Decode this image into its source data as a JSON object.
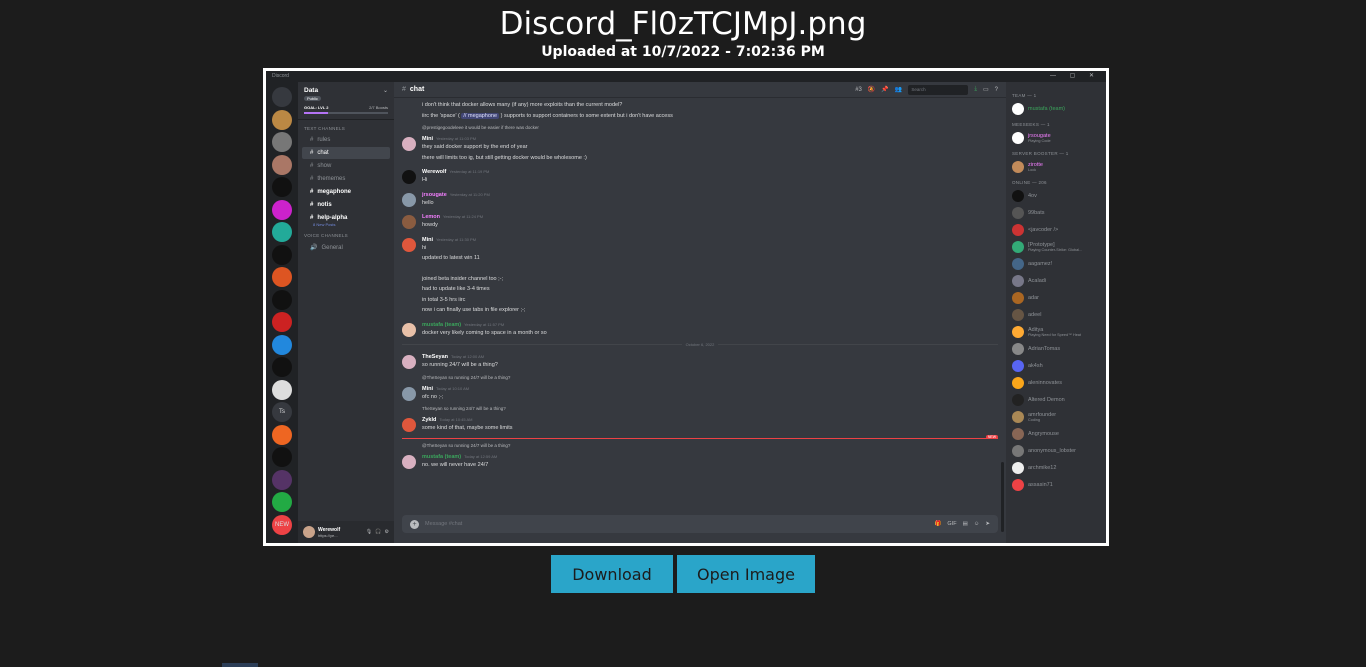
{
  "page": {
    "title": "Discord_Fl0zTCJMpJ.png",
    "uploaded": "Uploaded at 10/7/2022 - 7:02:36 PM",
    "download_label": "Download",
    "open_label": "Open Image"
  },
  "discord": {
    "app_name": "Discord",
    "guild": {
      "name": "Data",
      "public": "Public",
      "goal": "GOAL: LVL 2",
      "boosts": "2/7 Boosts"
    },
    "categories": {
      "text": "TEXT CHANNELS",
      "voice": "VOICE CHANNELS"
    },
    "channels": [
      {
        "name": "rules",
        "state": "normal"
      },
      {
        "name": "chat",
        "state": "active"
      },
      {
        "name": "show",
        "state": "normal"
      },
      {
        "name": "thememes",
        "state": "normal"
      },
      {
        "name": "megaphone",
        "state": "unread"
      },
      {
        "name": "notis",
        "state": "unread"
      },
      {
        "name": "help-alpha",
        "state": "unread",
        "sub": "8 New Posts"
      }
    ],
    "voice_channels": [
      {
        "name": "General"
      }
    ],
    "user": {
      "name": "Werewolf",
      "status": "https://ye..."
    },
    "header": {
      "channel": "chat",
      "search": "Search",
      "threads": "3"
    },
    "composer_placeholder": "Message #chat",
    "messages": [
      {
        "lines": [
          "i don't think that docker allows many (if any) more exploits than the current model?"
        ],
        "continuation": true
      },
      {
        "pre": "iirc the 'space' (",
        "mention": "// megaphone",
        "post": ") supports to support containers to some extent but i don't have access",
        "continuation": true
      },
      {
        "reply": "@prestigegoodeleee it would be easier if there was docker"
      },
      {
        "author": "Mini",
        "time": "Yesterday at 11:03 PM",
        "color": "#fff",
        "lines": [
          "they said docker support by the end of year",
          "there will limits too ig, but still getting docker would be wholesome :)"
        ]
      },
      {
        "author": "Werewolf",
        "time": "Yesterday at 11:19 PM",
        "color": "#fff",
        "lines": [
          "Hi"
        ]
      },
      {
        "author": "jrsougate",
        "time": "Yesterday at 11:20 PM",
        "color": "#f47fff",
        "lines": [
          "hello"
        ]
      },
      {
        "author": "Lemon",
        "time": "Yesterday at 11:24 PM",
        "color": "#f47fff",
        "lines": [
          "howdy"
        ]
      },
      {
        "author": "Mini",
        "time": "Yesterday at 11:30 PM",
        "color": "#fff",
        "lines": [
          "hi",
          "updated to latest win 11",
          "",
          "joined beta insider channel too ;-;",
          "had to update like 3-4 times",
          "in total 3-5 hrs iirc",
          "now i can finally use tabs in file explorer ;-;"
        ]
      },
      {
        "author": "mustafa (team)",
        "time": "Yesterday at 11:57 PM",
        "color": "#3ba55c",
        "lines": [
          "docker very likely coming to space in a month or so"
        ]
      },
      {
        "divider": "October 6, 2022"
      },
      {
        "author": "TheSeyan",
        "time": "Today at 12:00 AM",
        "color": "#fff",
        "lines": [
          "so running 24/7 will be a thing?"
        ]
      },
      {
        "reply": "@TheSeyan so running 24/7 will be a thing?"
      },
      {
        "author": "Mini",
        "time": "Today at 10:10 AM",
        "color": "#fff",
        "lines": [
          "ofc no ;-;"
        ]
      },
      {
        "reply": "TheSeyan so running 24/7 will be a thing?"
      },
      {
        "author": "Zykld",
        "time": "Today at 10:45 AM",
        "color": "#fff",
        "lines": [
          "some kind of that, maybe some limits"
        ]
      },
      {
        "newline": "NEW"
      },
      {
        "reply": "@TheSeyan so running 24/7 will be a thing?"
      },
      {
        "author": "mustafa (team)",
        "time": "Today at 12:59 AM",
        "color": "#3ba55c",
        "lines": [
          "no. we will never have 24/7"
        ]
      }
    ],
    "members": [
      {
        "cat": "TEAM — 1"
      },
      {
        "name": "mustafa (team)",
        "cls": "green",
        "color": "#ffffff"
      },
      {
        "cat": "MEESEEKS — 1"
      },
      {
        "name": "jrsougate",
        "cls": "pink",
        "sub": "Playing Code",
        "color": "#ffffff"
      },
      {
        "cat": "SERVER BOOSTER — 1"
      },
      {
        "name": "zirotte",
        "cls": "pink",
        "sub": "Lock",
        "color": "#c28b5a"
      },
      {
        "cat": "ONLINE — 206"
      },
      {
        "name": "4ov",
        "color": "#111"
      },
      {
        "name": "99bats",
        "color": "#555"
      },
      {
        "name": "<javcoder />",
        "color": "#c33"
      },
      {
        "name": "[Prototype]",
        "sub": "Playing Counter-Strike: Global...",
        "color": "#3a7"
      },
      {
        "name": "aagamez!",
        "color": "#468"
      },
      {
        "name": "Acaladi",
        "color": "#778"
      },
      {
        "name": "adar",
        "color": "#a62"
      },
      {
        "name": "adeel",
        "color": "#654"
      },
      {
        "name": "Aditya",
        "sub": "Playing Need for Speed™ Heat",
        "color": "#fa3"
      },
      {
        "name": "AdrianTomas",
        "color": "#888"
      },
      {
        "name": "ak4sh",
        "color": "#5865f2"
      },
      {
        "name": "aleninnovates",
        "color": "#faa61a"
      },
      {
        "name": "Altered Demon",
        "color": "#222"
      },
      {
        "name": "amrfounder",
        "sub": "Coding",
        "color": "#a85"
      },
      {
        "name": "Angrymouse",
        "color": "#865"
      },
      {
        "name": "anonymous_lobster",
        "color": "#777"
      },
      {
        "name": "archmike12",
        "color": "#eee"
      },
      {
        "name": "assasin71",
        "color": "#ed4245"
      }
    ],
    "servers": [
      {
        "label": "",
        "color": "#36393f",
        "badge": ""
      },
      {
        "label": "",
        "color": "#b84",
        "badge": "2"
      },
      {
        "label": "",
        "color": "#777",
        "badge": "4"
      },
      {
        "label": "",
        "color": "#a76",
        "badge": "2"
      },
      {
        "label": "",
        "color": "#111",
        "badge": "1"
      },
      {
        "label": "",
        "color": "#c2c",
        "badge": ""
      },
      {
        "label": "",
        "color": "#2a9",
        "badge": ""
      },
      {
        "label": "",
        "color": "#111",
        "badge": "15"
      },
      {
        "label": "",
        "color": "#d52",
        "badge": "1"
      },
      {
        "label": "",
        "color": "#111",
        "badge": "16"
      },
      {
        "label": "",
        "color": "#c22",
        "badge": "8"
      },
      {
        "label": "",
        "color": "#28d",
        "badge": ""
      },
      {
        "label": "",
        "color": "#111",
        "badge": "2"
      },
      {
        "label": "",
        "color": "#ddd",
        "badge": "8"
      },
      {
        "label": "Ts",
        "color": "#36393f",
        "badge": ""
      },
      {
        "label": "",
        "color": "#e62",
        "badge": ""
      },
      {
        "label": "",
        "color": "#111",
        "badge": "16"
      },
      {
        "label": "",
        "color": "#536",
        "badge": "3"
      },
      {
        "label": "",
        "color": "#2a4",
        "badge": ""
      },
      {
        "label": "NEW",
        "color": "#ed4245",
        "badge": ""
      }
    ],
    "top_badge": "230"
  }
}
